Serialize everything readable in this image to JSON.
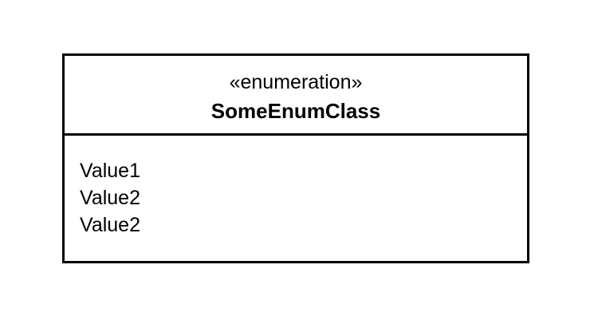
{
  "diagram": {
    "stereotype": "«enumeration»",
    "class_name": "SomeEnumClass",
    "values": [
      "Value1",
      "Value2",
      "Value2"
    ],
    "colors": {
      "border": "#000000",
      "text": "#000000",
      "background": "#ffffff"
    }
  }
}
